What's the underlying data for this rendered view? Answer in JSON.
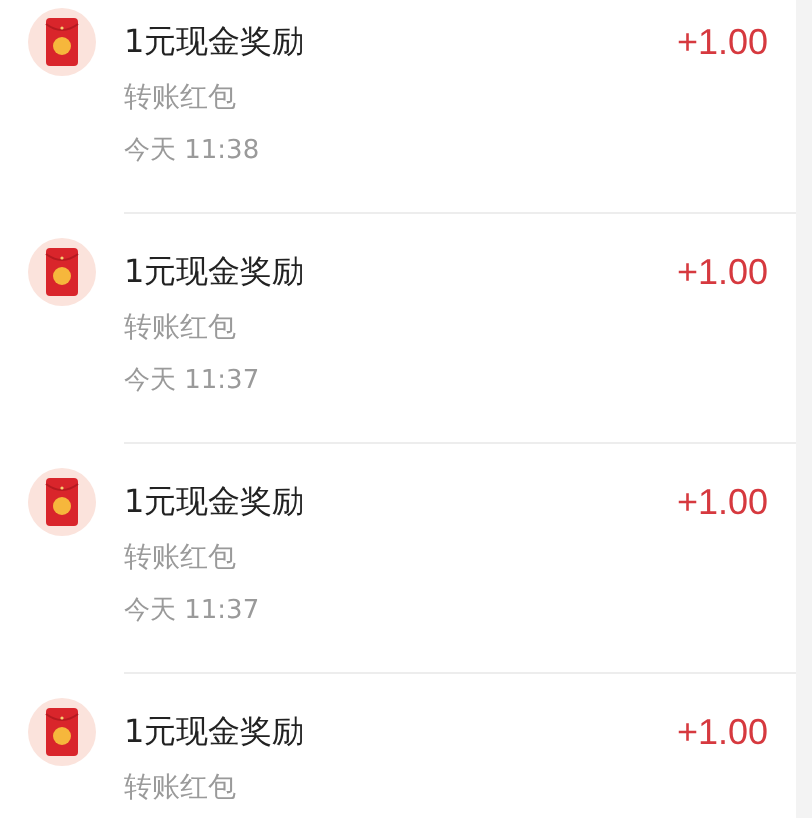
{
  "transactions": [
    {
      "title": "1元现金奖励",
      "subtitle": "转账红包",
      "time": "今天 11:38",
      "amount": "+1.00"
    },
    {
      "title": "1元现金奖励",
      "subtitle": "转账红包",
      "time": "今天 11:37",
      "amount": "+1.00"
    },
    {
      "title": "1元现金奖励",
      "subtitle": "转账红包",
      "time": "今天 11:37",
      "amount": "+1.00"
    },
    {
      "title": "1元现金奖励",
      "subtitle": "转账红包",
      "amount": "+1.00"
    }
  ]
}
